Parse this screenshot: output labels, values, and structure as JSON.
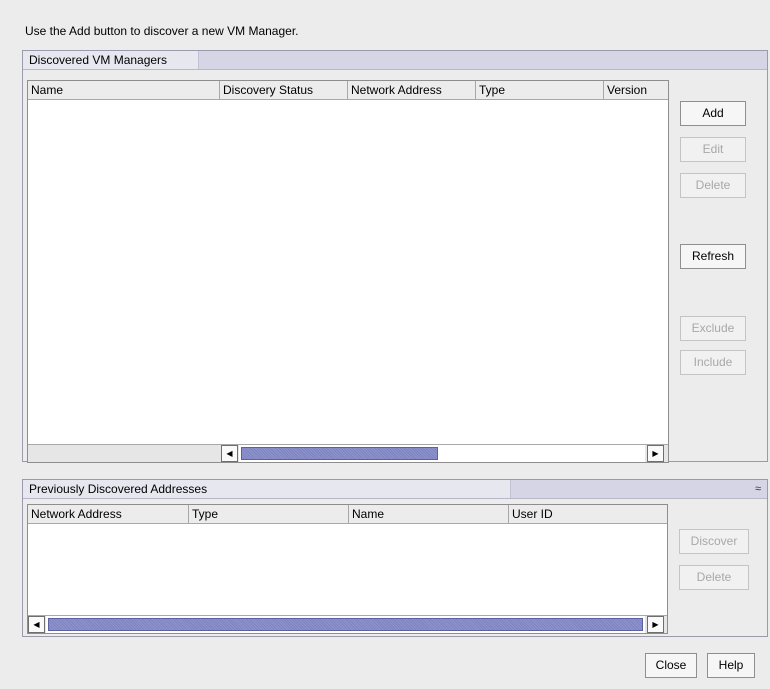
{
  "instruction": "Use the Add button to discover a new VM Manager.",
  "discovered_panel": {
    "title": "Discovered VM Managers",
    "columns": [
      "Name",
      "Discovery Status",
      "Network Address",
      "Type",
      "Version"
    ],
    "rows": [],
    "buttons": {
      "add": "Add",
      "edit": "Edit",
      "delete": "Delete",
      "refresh": "Refresh",
      "exclude": "Exclude",
      "include": "Include"
    }
  },
  "previous_panel": {
    "title": "Previously Discovered Addresses",
    "columns": [
      "Network Address",
      "Type",
      "Name",
      "User ID"
    ],
    "rows": [],
    "buttons": {
      "discover": "Discover",
      "delete": "Delete"
    }
  },
  "footer": {
    "close": "Close",
    "help": "Help"
  },
  "icons": {
    "collapse": "double-chevron-up-icon",
    "scroll_left": "arrow-left-icon",
    "scroll_right": "arrow-right-icon"
  }
}
